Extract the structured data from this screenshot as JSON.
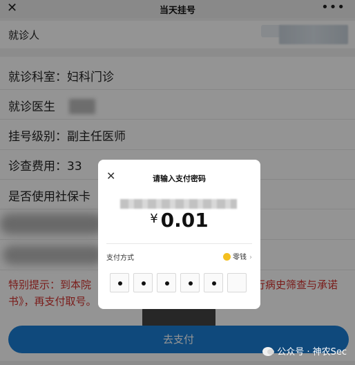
{
  "titlebar": {
    "title": "当天挂号",
    "close": "✕",
    "more": "•••"
  },
  "patient": {
    "label": "就诊人"
  },
  "rows": [
    {
      "label": "就诊科室：",
      "value": "妇科门诊"
    },
    {
      "label": "就诊医生",
      "value": ""
    },
    {
      "label": "挂号级别：",
      "value": "副主任医师"
    },
    {
      "label": "诊查费用：",
      "value": "33"
    },
    {
      "label": "是否使用社保卡",
      "value": ""
    }
  ],
  "notice": {
    "line1": "特别提示：到本院",
    "line1_right": "行病史筛查与承诺",
    "line2": "书》，再支付取号。"
  },
  "pay_button": "去支付",
  "watermark": "公众号 · 神农Sec",
  "modal": {
    "close": "✕",
    "title": "请输入支付密码",
    "currency": "¥",
    "amount": "0.01",
    "pay_method_label": "支付方式",
    "pay_method_value": "零钱",
    "chevron": "›",
    "pin_filled": 5,
    "pin_total": 6
  },
  "colors": {
    "accent": "#1a7fd6",
    "notice": "#d2312d",
    "coin": "#f4c020"
  }
}
